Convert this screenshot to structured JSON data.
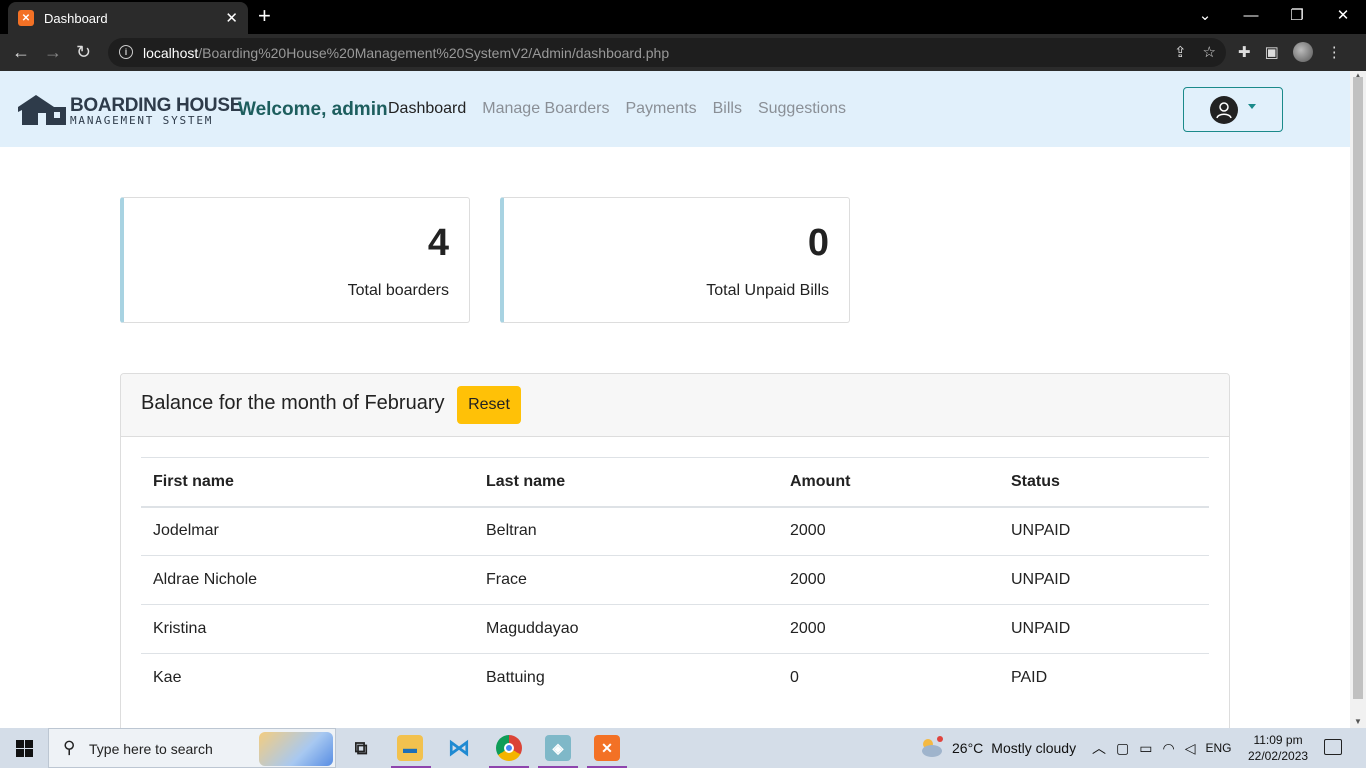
{
  "browser": {
    "tab_title": "Dashboard",
    "url_host": "localhost",
    "url_path": "/Boarding%20House%20Management%20SystemV2/Admin/dashboard.php"
  },
  "navbar": {
    "logo_line1": "BOARDING HOUSE",
    "logo_line2": "MANAGEMENT SYSTEM",
    "welcome": "Welcome, admin",
    "links": [
      "Dashboard",
      "Manage Boarders",
      "Payments",
      "Bills",
      "Suggestions"
    ],
    "active_link": "Dashboard"
  },
  "stats": [
    {
      "value": "4",
      "label": "Total boarders"
    },
    {
      "value": "0",
      "label": "Total Unpaid Bills"
    }
  ],
  "balance": {
    "title": "Balance for the month of February",
    "reset_label": "Reset",
    "columns": [
      "First name",
      "Last name",
      "Amount",
      "Status"
    ],
    "rows": [
      [
        "Jodelmar",
        "Beltran",
        "2000",
        "UNPAID"
      ],
      [
        "Aldrae Nichole",
        "Frace",
        "2000",
        "UNPAID"
      ],
      [
        "Kristina",
        "Maguddayao",
        "2000",
        "UNPAID"
      ],
      [
        "Kae",
        "Battuing",
        "0",
        "PAID"
      ]
    ]
  },
  "taskbar": {
    "search_placeholder": "Type here to search",
    "temperature": "26°C",
    "weather": "Mostly cloudy",
    "language": "ENG",
    "time": "11:09 pm",
    "date": "22/02/2023"
  },
  "colors": {
    "navbar_bg": "#e1f0fb",
    "welcome": "#1d5e5e",
    "reset_button": "#ffc107",
    "stat_accent": "#a8d3e2"
  }
}
